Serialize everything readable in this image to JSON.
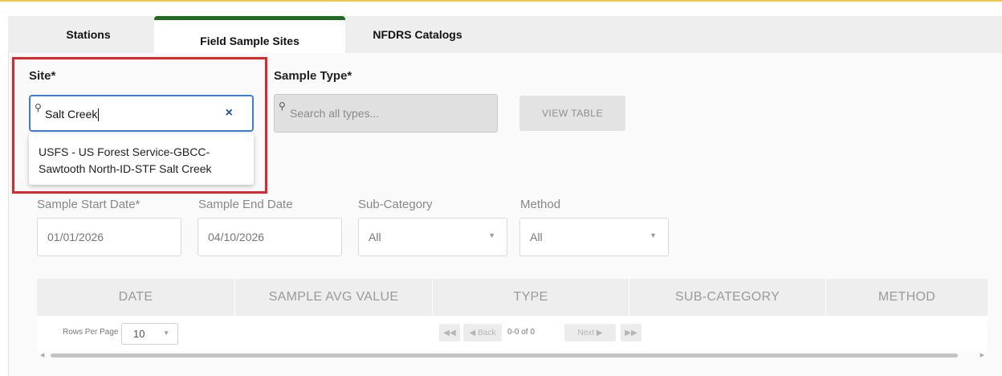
{
  "tabs": [
    {
      "label": "Stations",
      "active": false
    },
    {
      "label": "Field Sample Sites",
      "active": true
    },
    {
      "label": "NFDRS Catalogs",
      "active": false
    }
  ],
  "form": {
    "site_label": "Site*",
    "site_value": "Salt Creek",
    "site_clear_icon": "×",
    "site_option": "USFS - US Forest Service-GBCC-Sawtooth North-ID-STF Salt Creek",
    "sample_type_label": "Sample Type*",
    "sample_type_placeholder": "Search all types...",
    "view_table_label": "VIEW TABLE",
    "search_icon": "⚲"
  },
  "filters": {
    "start_date_label": "Sample Start Date*",
    "start_date_value": "01/01/2026",
    "end_date_label": "Sample End Date",
    "end_date_value": "04/10/2026",
    "subcategory_label": "Sub-Category",
    "subcategory_value": "All",
    "method_label": "Method",
    "method_value": "All"
  },
  "table": {
    "columns": [
      "DATE",
      "SAMPLE AVG VALUE",
      "TYPE",
      "SUB-CATEGORY",
      "METHOD"
    ],
    "rows_per_page_label": "Rows Per Page",
    "rows_per_page_value": "10",
    "first_label": "◀◀",
    "back_label": "◀ Back",
    "page_info": "0-0 of 0",
    "next_label": "Next ▶",
    "last_label": "▶▶"
  },
  "colors": {
    "accent_tab": "#1f6b1f",
    "highlight": "#e0252b",
    "focus_border": "#3b7dd8"
  }
}
